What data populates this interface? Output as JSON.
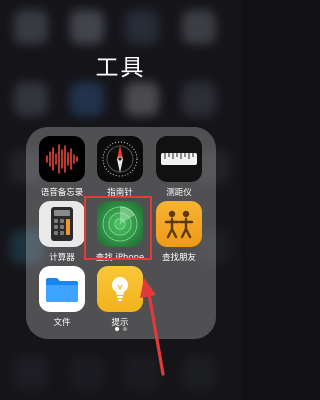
{
  "folder": {
    "title": "工具",
    "apps": [
      {
        "label": "语音备忘录",
        "icon": "voice-memos-icon"
      },
      {
        "label": "指南针",
        "icon": "compass-icon"
      },
      {
        "label": "测距仪",
        "icon": "measure-icon"
      },
      {
        "label": "计算器",
        "icon": "calculator-icon"
      },
      {
        "label": "查找 iPhone",
        "icon": "find-iphone-icon"
      },
      {
        "label": "查找朋友",
        "icon": "find-friends-icon"
      },
      {
        "label": "文件",
        "icon": "files-icon"
      },
      {
        "label": "提示",
        "icon": "tips-icon"
      }
    ]
  },
  "annotation": {
    "highlight_color": "#e23a3a",
    "highlighted_app": "查找 iPhone"
  },
  "page_indicator": {
    "pages": 2,
    "current": 1
  }
}
